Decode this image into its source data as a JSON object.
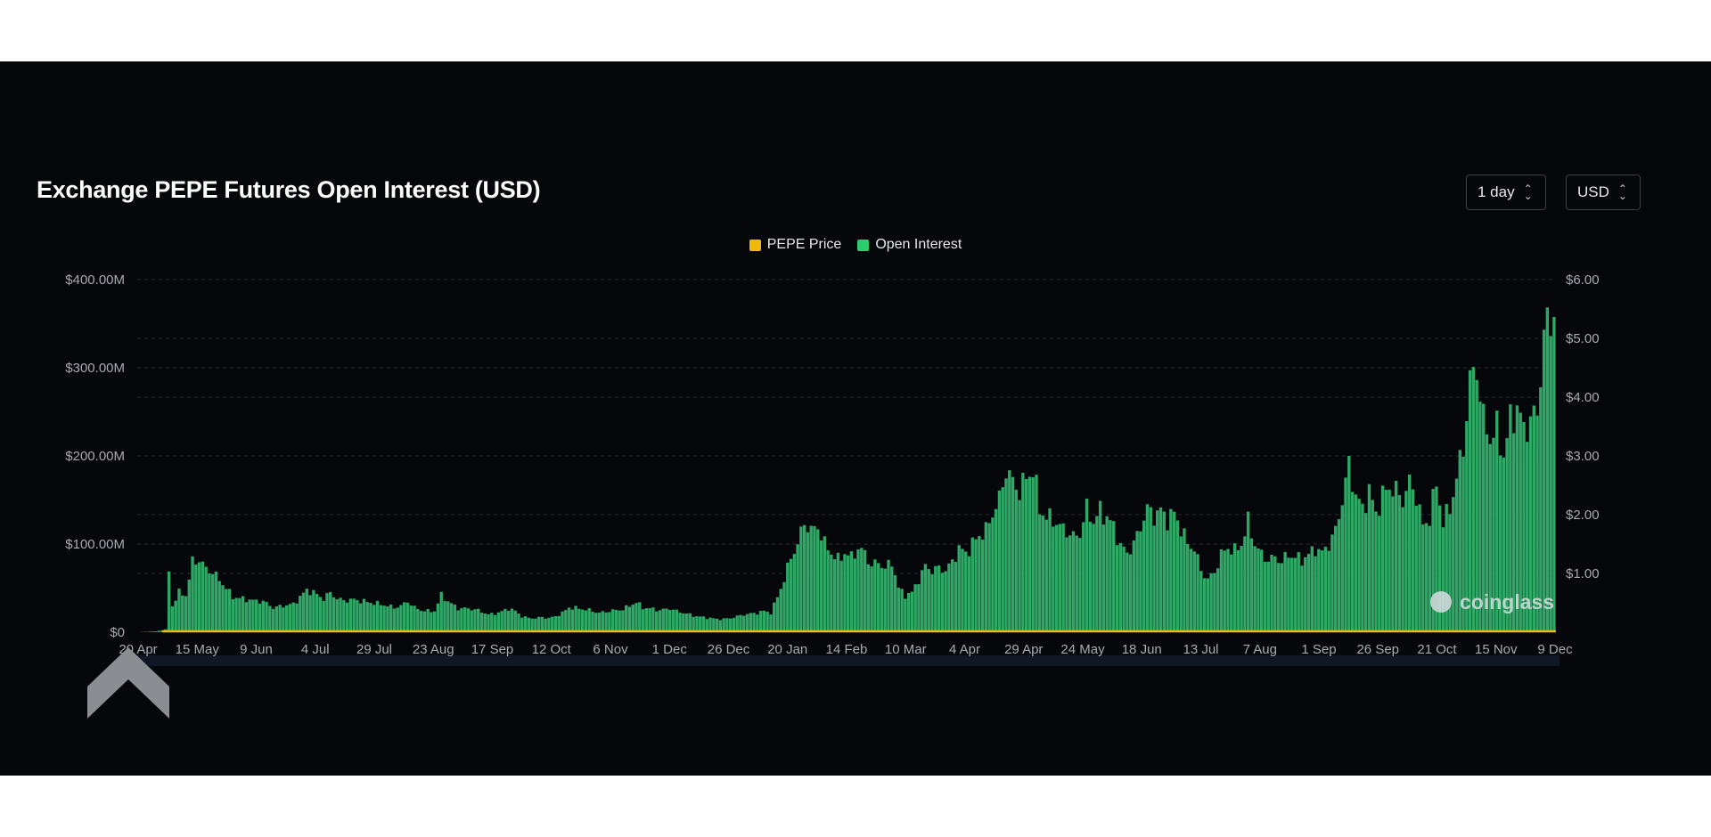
{
  "title": "Exchange PEPE Futures Open Interest (USD)",
  "controls": {
    "interval": {
      "value": "1 day"
    },
    "currency": {
      "value": "USD"
    }
  },
  "legend": [
    {
      "label": "PEPE Price",
      "color": "#f0b90b"
    },
    {
      "label": "Open Interest",
      "color": "#2ecc71"
    }
  ],
  "watermark": "coinglass",
  "colors": {
    "background": "#05070b",
    "bars": "#2fa866",
    "price_line": "#f0b90b",
    "grid": "#2a2e35",
    "text": "#a7abb2"
  },
  "chart_data": {
    "type": "bar",
    "x_tick_labels": [
      "20 Apr",
      "15 May",
      "9 Jun",
      "4 Jul",
      "29 Jul",
      "23 Aug",
      "17 Sep",
      "12 Oct",
      "6 Nov",
      "1 Dec",
      "26 Dec",
      "20 Jan",
      "14 Feb",
      "10 Mar",
      "4 Apr",
      "29 Apr",
      "24 May",
      "18 Jun",
      "13 Jul",
      "7 Aug",
      "1 Sep",
      "26 Sep",
      "21 Oct",
      "15 Nov",
      "9 Dec"
    ],
    "y_left": {
      "ticks": [
        "$0",
        "$100.00M",
        "$200.00M",
        "$300.00M",
        "$400.00M"
      ],
      "range": [
        0,
        400
      ]
    },
    "y_right": {
      "ticks": [
        "$1.00",
        "$2.00",
        "$3.00",
        "$4.00",
        "$5.00",
        "$6.00"
      ],
      "range": [
        0,
        6
      ]
    },
    "grid": true,
    "legend_position": "top-center",
    "series": [
      {
        "name": "Open Interest",
        "axis": "left",
        "unit": "M USD",
        "anchors": [
          [
            0,
            0
          ],
          [
            5,
            1
          ],
          [
            8,
            3
          ],
          [
            9,
            70
          ],
          [
            10,
            30
          ],
          [
            12,
            45
          ],
          [
            14,
            42
          ],
          [
            15,
            60
          ],
          [
            16,
            80
          ],
          [
            18,
            82
          ],
          [
            20,
            72
          ],
          [
            22,
            68
          ],
          [
            25,
            55
          ],
          [
            28,
            40
          ],
          [
            31,
            38
          ],
          [
            34,
            36
          ],
          [
            37,
            35
          ],
          [
            40,
            28
          ],
          [
            43,
            30
          ],
          [
            46,
            32
          ],
          [
            48,
            40
          ],
          [
            50,
            48
          ],
          [
            52,
            45
          ],
          [
            55,
            38
          ],
          [
            57,
            45
          ],
          [
            59,
            38
          ],
          [
            61,
            36
          ],
          [
            64,
            37
          ],
          [
            67,
            35
          ],
          [
            70,
            33
          ],
          [
            73,
            31
          ],
          [
            76,
            28
          ],
          [
            78,
            30
          ],
          [
            80,
            35
          ],
          [
            82,
            28
          ],
          [
            84,
            25
          ],
          [
            86,
            24
          ],
          [
            88,
            24
          ],
          [
            90,
            42
          ],
          [
            92,
            35
          ],
          [
            95,
            27
          ],
          [
            98,
            27
          ],
          [
            101,
            25
          ],
          [
            104,
            20
          ],
          [
            107,
            22
          ],
          [
            110,
            27
          ],
          [
            112,
            24
          ],
          [
            114,
            18
          ],
          [
            116,
            16
          ],
          [
            118,
            16
          ],
          [
            120,
            17
          ],
          [
            122,
            16
          ],
          [
            124,
            18
          ],
          [
            126,
            22
          ],
          [
            128,
            28
          ],
          [
            131,
            27
          ],
          [
            134,
            25
          ],
          [
            137,
            22
          ],
          [
            140,
            24
          ],
          [
            142,
            25
          ],
          [
            144,
            26
          ],
          [
            146,
            30
          ],
          [
            148,
            34
          ],
          [
            150,
            28
          ],
          [
            152,
            27
          ],
          [
            155,
            25
          ],
          [
            158,
            27
          ],
          [
            160,
            24
          ],
          [
            162,
            22
          ],
          [
            164,
            20
          ],
          [
            166,
            18
          ],
          [
            168,
            17
          ],
          [
            170,
            16
          ],
          [
            172,
            15
          ],
          [
            174,
            15
          ],
          [
            176,
            16
          ],
          [
            178,
            18
          ],
          [
            180,
            20
          ],
          [
            182,
            21
          ],
          [
            184,
            22
          ],
          [
            186,
            24
          ],
          [
            188,
            22
          ],
          [
            190,
            40
          ],
          [
            192,
            60
          ],
          [
            194,
            85
          ],
          [
            196,
            100
          ],
          [
            198,
            125
          ],
          [
            200,
            115
          ],
          [
            202,
            120
          ],
          [
            204,
            100
          ],
          [
            206,
            90
          ],
          [
            208,
            82
          ],
          [
            210,
            90
          ],
          [
            212,
            85
          ],
          [
            214,
            95
          ],
          [
            216,
            90
          ],
          [
            218,
            75
          ],
          [
            220,
            80
          ],
          [
            222,
            72
          ],
          [
            224,
            80
          ],
          [
            226,
            50
          ],
          [
            228,
            42
          ],
          [
            230,
            45
          ],
          [
            232,
            60
          ],
          [
            234,
            75
          ],
          [
            236,
            70
          ],
          [
            238,
            73
          ],
          [
            240,
            70
          ],
          [
            242,
            80
          ],
          [
            244,
            95
          ],
          [
            246,
            90
          ],
          [
            248,
            100
          ],
          [
            250,
            110
          ],
          [
            252,
            115
          ],
          [
            254,
            135
          ],
          [
            256,
            150
          ],
          [
            258,
            185
          ],
          [
            260,
            170
          ],
          [
            262,
            160
          ],
          [
            264,
            175
          ],
          [
            266,
            185
          ],
          [
            268,
            140
          ],
          [
            270,
            130
          ],
          [
            272,
            128
          ],
          [
            274,
            120
          ],
          [
            276,
            115
          ],
          [
            278,
            108
          ],
          [
            280,
            112
          ],
          [
            282,
            140
          ],
          [
            284,
            125
          ],
          [
            286,
            138
          ],
          [
            288,
            130
          ],
          [
            290,
            120
          ],
          [
            292,
            98
          ],
          [
            294,
            90
          ],
          [
            296,
            100
          ],
          [
            298,
            120
          ],
          [
            300,
            140
          ],
          [
            302,
            132
          ],
          [
            304,
            138
          ],
          [
            306,
            128
          ],
          [
            308,
            135
          ],
          [
            310,
            118
          ],
          [
            312,
            100
          ],
          [
            314,
            95
          ],
          [
            316,
            70
          ],
          [
            318,
            60
          ],
          [
            320,
            68
          ],
          [
            322,
            88
          ],
          [
            324,
            96
          ],
          [
            326,
            92
          ],
          [
            328,
            100
          ],
          [
            330,
            125
          ],
          [
            332,
            100
          ],
          [
            334,
            88
          ],
          [
            336,
            82
          ],
          [
            338,
            85
          ],
          [
            340,
            80
          ],
          [
            342,
            88
          ],
          [
            344,
            85
          ],
          [
            346,
            82
          ],
          [
            348,
            88
          ],
          [
            350,
            95
          ],
          [
            352,
            90
          ],
          [
            354,
            100
          ],
          [
            356,
            115
          ],
          [
            358,
            150
          ],
          [
            360,
            190
          ],
          [
            362,
            155
          ],
          [
            364,
            140
          ],
          [
            366,
            160
          ],
          [
            368,
            135
          ],
          [
            370,
            155
          ],
          [
            372,
            165
          ],
          [
            374,
            160
          ],
          [
            376,
            150
          ],
          [
            378,
            170
          ],
          [
            380,
            155
          ],
          [
            382,
            120
          ],
          [
            384,
            130
          ],
          [
            386,
            168
          ],
          [
            388,
            125
          ],
          [
            390,
            140
          ],
          [
            392,
            175
          ],
          [
            394,
            210
          ],
          [
            396,
            285
          ],
          [
            398,
            300
          ],
          [
            400,
            240
          ],
          [
            402,
            220
          ],
          [
            404,
            230
          ],
          [
            406,
            200
          ],
          [
            408,
            240
          ],
          [
            410,
            255
          ],
          [
            412,
            230
          ],
          [
            414,
            240
          ],
          [
            416,
            250
          ],
          [
            418,
            335
          ],
          [
            420,
            360
          ],
          [
            421,
            360
          ]
        ]
      },
      {
        "name": "PEPE Price",
        "axis": "right",
        "unit": "USD",
        "note": "line near zero",
        "anchors": [
          [
            0,
            1.2e-06
          ],
          [
            421,
            2.5e-05
          ]
        ]
      }
    ]
  }
}
